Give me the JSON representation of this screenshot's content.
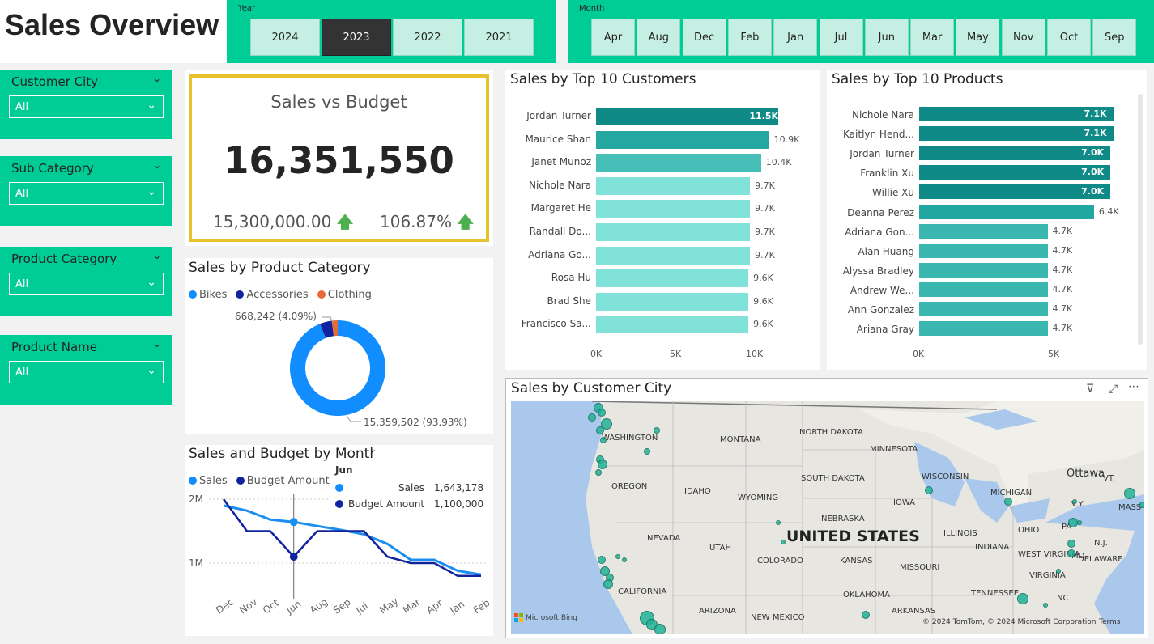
{
  "header": {
    "title": "Sales Overview"
  },
  "year_slicer": {
    "caption": "Year",
    "items": [
      "2024",
      "2023",
      "2022",
      "2021"
    ],
    "selected": "2023"
  },
  "month_slicer": {
    "caption": "Month",
    "items": [
      "Apr",
      "Aug",
      "Dec",
      "Feb",
      "Jan",
      "Jul",
      "Jun",
      "Mar",
      "May",
      "Nov",
      "Oct",
      "Sep"
    ]
  },
  "filters": [
    {
      "label": "Customer City",
      "value": "All"
    },
    {
      "label": "Sub Category",
      "value": "All"
    },
    {
      "label": "Product Category",
      "value": "All"
    },
    {
      "label": "Product Name",
      "value": "All"
    }
  ],
  "kpi": {
    "title": "Sales vs Budget",
    "value": "16,351,550",
    "target": "15,300,000.00",
    "percent": "106.87%",
    "arrow_color": "#4caf50"
  },
  "colors": {
    "accent": "#00cc96",
    "kpi_border": "#e8c22e",
    "bikes": "#118dff",
    "accessories": "#12239e",
    "clothing": "#e66c37"
  },
  "product_category": {
    "title": "Sales by Product Category",
    "legend": [
      "Bikes",
      "Accessories",
      "Clothing"
    ],
    "label_small": "668,242 (4.09%)",
    "label_big": "15,359,502 (93.93%)"
  },
  "line_chart": {
    "title": "Sales and Budget by Month",
    "legend": [
      "Sales",
      "Budget Amount"
    ],
    "y_ticks": [
      "2M",
      "1M"
    ],
    "tooltip": {
      "header": "Jun",
      "rows": [
        {
          "label": "Sales",
          "value": "1,643,178"
        },
        {
          "label": "Budget Amount",
          "value": "1,100,000"
        }
      ]
    }
  },
  "customers": {
    "title": "Sales by Top 10 Customers",
    "axis": [
      "0K",
      "5K",
      "10K"
    ]
  },
  "products": {
    "title": "Sales by Top 10 Products",
    "axis": [
      "0K",
      "5K"
    ]
  },
  "map": {
    "title": "Sales by Customer City",
    "country": "UNITED STATES",
    "states": [
      "WASHINGTON",
      "MONTANA",
      "NORTH DAKOTA",
      "MINNESOTA",
      "OREGON",
      "IDAHO",
      "SOUTH DAKOTA",
      "WISCONSIN",
      "WYOMING",
      "MICHIGAN",
      "IOWA",
      "NEBRASKA",
      "ILLINOIS",
      "OHIO",
      "NEVADA",
      "UTAH",
      "COLORADO",
      "KANSAS",
      "MISSOURI",
      "INDIANA",
      "WEST VIRGINIA",
      "VIRGINIA",
      "CALIFORNIA",
      "TENNESSEE",
      "OKLAHOMA",
      "ARIZONA",
      "NEW MEXICO",
      "ARKANSAS",
      "NC",
      "N.Y.",
      "PA",
      "N.J.",
      "MD",
      "DELAWARE",
      "VT.",
      "MASS",
      "Ottawa"
    ],
    "bing": "Microsoft Bing",
    "copyright": "© 2024 TomTom, © 2024 Microsoft Corporation",
    "terms": "Terms"
  },
  "chart_data": [
    {
      "type": "bar",
      "title": "Sales by Top 10 Customers",
      "orientation": "horizontal",
      "categories": [
        "Jordan Turner",
        "Maurice Shan",
        "Janet Munoz",
        "Nichole Nara",
        "Margaret He",
        "Randall Do...",
        "Adriana Go...",
        "Rosa Hu",
        "Brad She",
        "Francisco Sa..."
      ],
      "values": [
        11.5,
        10.9,
        10.4,
        9.7,
        9.7,
        9.7,
        9.7,
        9.6,
        9.6,
        9.6
      ],
      "labels": [
        "11.5K",
        "10.9K",
        "10.4K",
        "9.7K",
        "9.7K",
        "9.7K",
        "9.7K",
        "9.6K",
        "9.6K",
        "9.6K"
      ],
      "xlim": [
        0,
        12.4
      ],
      "xticks": [
        "0K",
        "5K",
        "10K"
      ]
    },
    {
      "type": "bar",
      "title": "Sales by Top 10 Products",
      "orientation": "horizontal",
      "categories": [
        "Nichole Nara",
        "Kaitlyn Hend...",
        "Jordan Turner",
        "Franklin Xu",
        "Willie Xu",
        "Deanna Perez",
        "Adriana Gon...",
        "Alan Huang",
        "Alyssa Bradley",
        "Andrew We...",
        "Ann Gonzalez",
        "Ariana Gray"
      ],
      "values": [
        7.1,
        7.1,
        7.0,
        7.0,
        7.0,
        6.4,
        4.7,
        4.7,
        4.7,
        4.7,
        4.7,
        4.7
      ],
      "labels": [
        "7.1K",
        "7.1K",
        "7.0K",
        "7.0K",
        "7.0K",
        "6.4K",
        "4.7K",
        "4.7K",
        "4.7K",
        "4.7K",
        "4.7K",
        "4.7K"
      ],
      "xlim": [
        0,
        7.5
      ],
      "xticks": [
        "0K",
        "5K"
      ]
    },
    {
      "type": "pie",
      "title": "Sales by Product Category",
      "donut": true,
      "categories": [
        "Bikes",
        "Accessories",
        "Clothing"
      ],
      "values": [
        93.93,
        4.09,
        1.98
      ]
    },
    {
      "type": "line",
      "title": "Sales and Budget by Month",
      "x": [
        "Dec",
        "Nov",
        "Oct",
        "Jun",
        "Aug",
        "Sep",
        "Jul",
        "May",
        "Mar",
        "Apr",
        "Jan",
        "Feb"
      ],
      "series": [
        {
          "name": "Sales",
          "values": [
            1.9,
            1.82,
            1.68,
            1.643,
            1.58,
            1.52,
            1.45,
            1.3,
            1.05,
            1.05,
            0.88,
            0.82
          ]
        },
        {
          "name": "Budget Amount",
          "values": [
            2.0,
            1.5,
            1.5,
            1.1,
            1.5,
            1.5,
            1.5,
            1.1,
            1.0,
            1.0,
            0.8,
            0.8
          ]
        }
      ],
      "ylim": [
        0.6,
        2.2
      ],
      "yticks": [
        "2M",
        "1M"
      ]
    }
  ]
}
